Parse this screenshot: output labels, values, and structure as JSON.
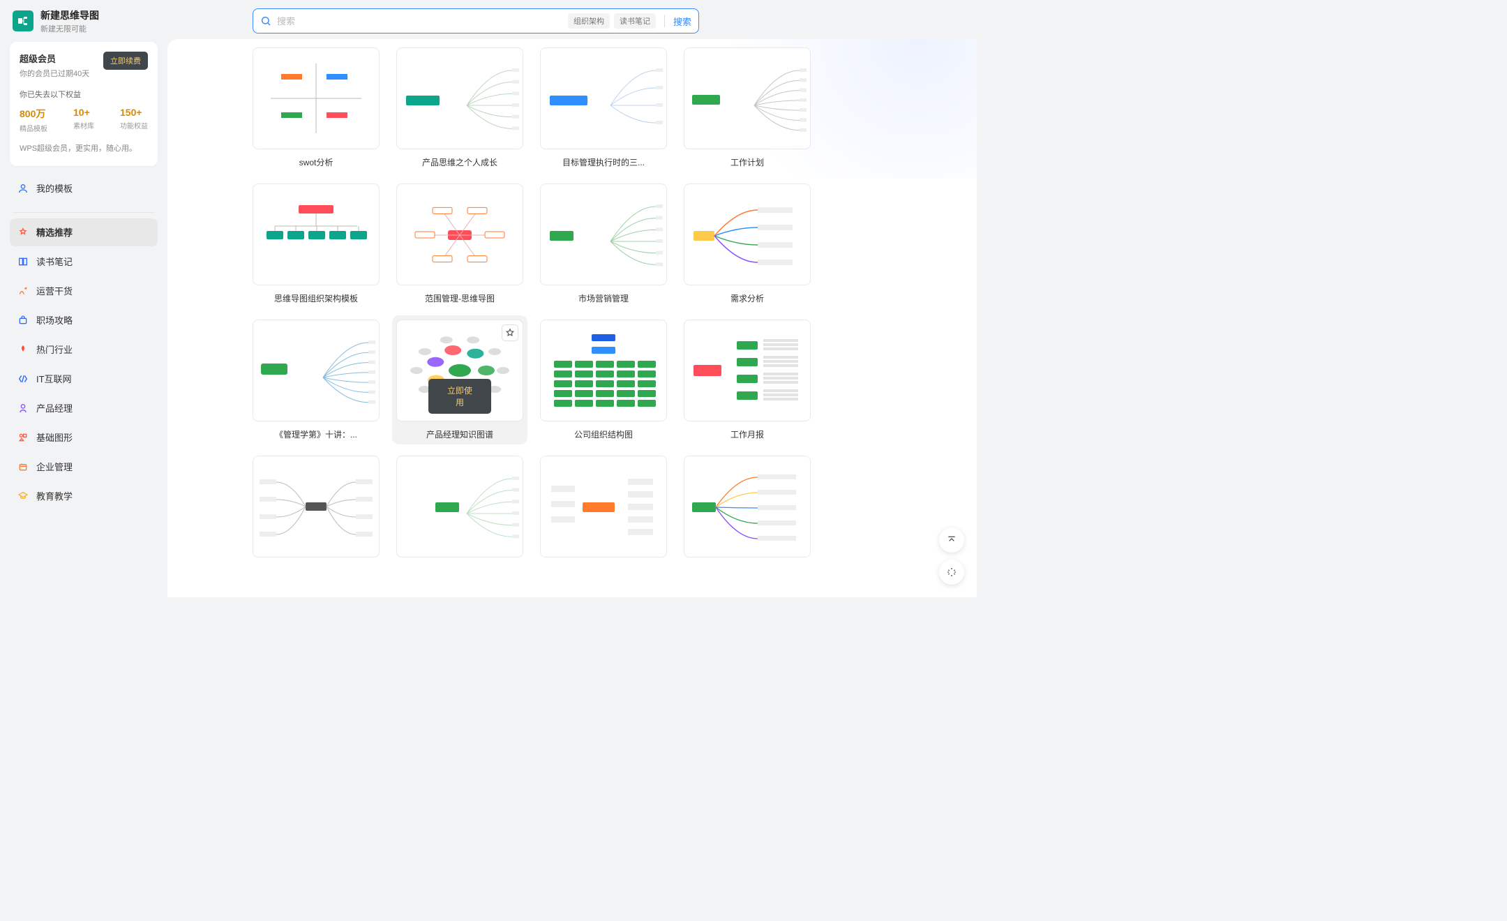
{
  "header": {
    "title": "新建思维导图",
    "subtitle": "新建无限可能"
  },
  "search": {
    "placeholder": "搜索",
    "hot_terms": [
      "组织架构",
      "读书笔记"
    ],
    "button": "搜索"
  },
  "membership": {
    "title": "超级会员",
    "expired_text": "你的会员已过期40天",
    "renew_button": "立即续费",
    "lost_text": "你已失去以下权益",
    "stats": [
      {
        "num": "800万",
        "label": "精品模板"
      },
      {
        "num": "10+",
        "label": "素材库"
      },
      {
        "num": "150+",
        "label": "功能权益"
      }
    ],
    "footer": "WPS超级会员，更实用，随心用。"
  },
  "sidebar": {
    "my_templates": "我的模板",
    "categories": [
      {
        "label": "精选推荐",
        "color": "#ff5a3c"
      },
      {
        "label": "读书笔记",
        "color": "#2f6bff"
      },
      {
        "label": "运营干货",
        "color": "#ff7a2d"
      },
      {
        "label": "职场攻略",
        "color": "#2f6bff"
      },
      {
        "label": "热门行业",
        "color": "#ff4d2e"
      },
      {
        "label": "IT互联网",
        "color": "#2f6bff"
      },
      {
        "label": "产品经理",
        "color": "#8a4bff"
      },
      {
        "label": "基础图形",
        "color": "#ff5a3c"
      },
      {
        "label": "企业管理",
        "color": "#ff7a2d"
      },
      {
        "label": "教育教学",
        "color": "#ffb02e"
      }
    ]
  },
  "templates": [
    {
      "title": "swot分析"
    },
    {
      "title": "产品思维之个人成长"
    },
    {
      "title": "目标管理执行时的三..."
    },
    {
      "title": "工作计划"
    },
    {
      "title": "思维导图组织架构模板"
    },
    {
      "title": "范围管理-思维导图"
    },
    {
      "title": "市场营销管理"
    },
    {
      "title": "需求分析"
    },
    {
      "title": "《管理学第》十讲：..."
    },
    {
      "title": "产品经理知识图谱",
      "hovered": true,
      "use_label": "立即使用"
    },
    {
      "title": "公司组织结构图"
    },
    {
      "title": "工作月报"
    },
    {
      "title": ""
    },
    {
      "title": ""
    },
    {
      "title": ""
    },
    {
      "title": ""
    }
  ],
  "thumb_colors": {
    "teal": "#0aa58a",
    "blue_box": "#2f8fff",
    "blue_deep": "#1e5fe6",
    "orange": "#ff7a2d",
    "red": "#ff4d5a",
    "green": "#2fa84f",
    "purple": "#8a4bff",
    "yellow": "#ffc94a"
  }
}
